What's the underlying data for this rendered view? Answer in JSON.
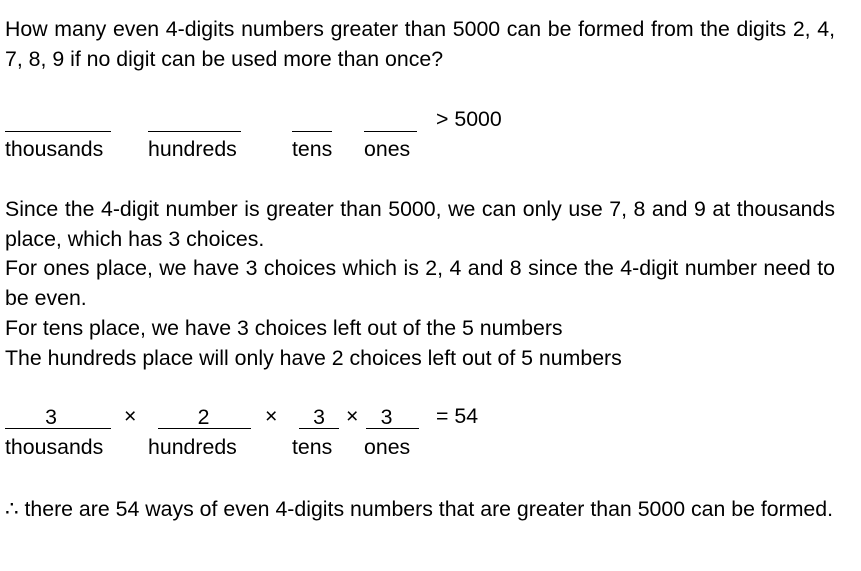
{
  "question": "How many even 4-digits numbers greater than 5000 can be formed from the digits 2, 4, 7, 8, 9 if no digit can be used more than once?",
  "diagram1": {
    "labels": [
      "thousands",
      "hundreds",
      "tens",
      "ones"
    ],
    "condition": "> 5000"
  },
  "explanation": {
    "line1": "Since the 4-digit number is greater than 5000, we can only use 7, 8 and 9 at thousands place, which has 3 choices.",
    "line2": "For ones place, we have 3 choices which is 2, 4 and 8 since the 4-digit number need to be even.",
    "line3": "For tens place, we have 3 choices left out of the 5 numbers",
    "line4": "The hundreds place will only have 2 choices left out of 5 numbers"
  },
  "diagram2": {
    "values": [
      "3",
      "2",
      "3",
      "3"
    ],
    "labels": [
      "thousands",
      "hundreds",
      "tens",
      "ones"
    ],
    "times": "×",
    "result": "= 54"
  },
  "conclusion": "∴ there are 54 ways of even 4-digits numbers that are greater than 5000 can be formed."
}
